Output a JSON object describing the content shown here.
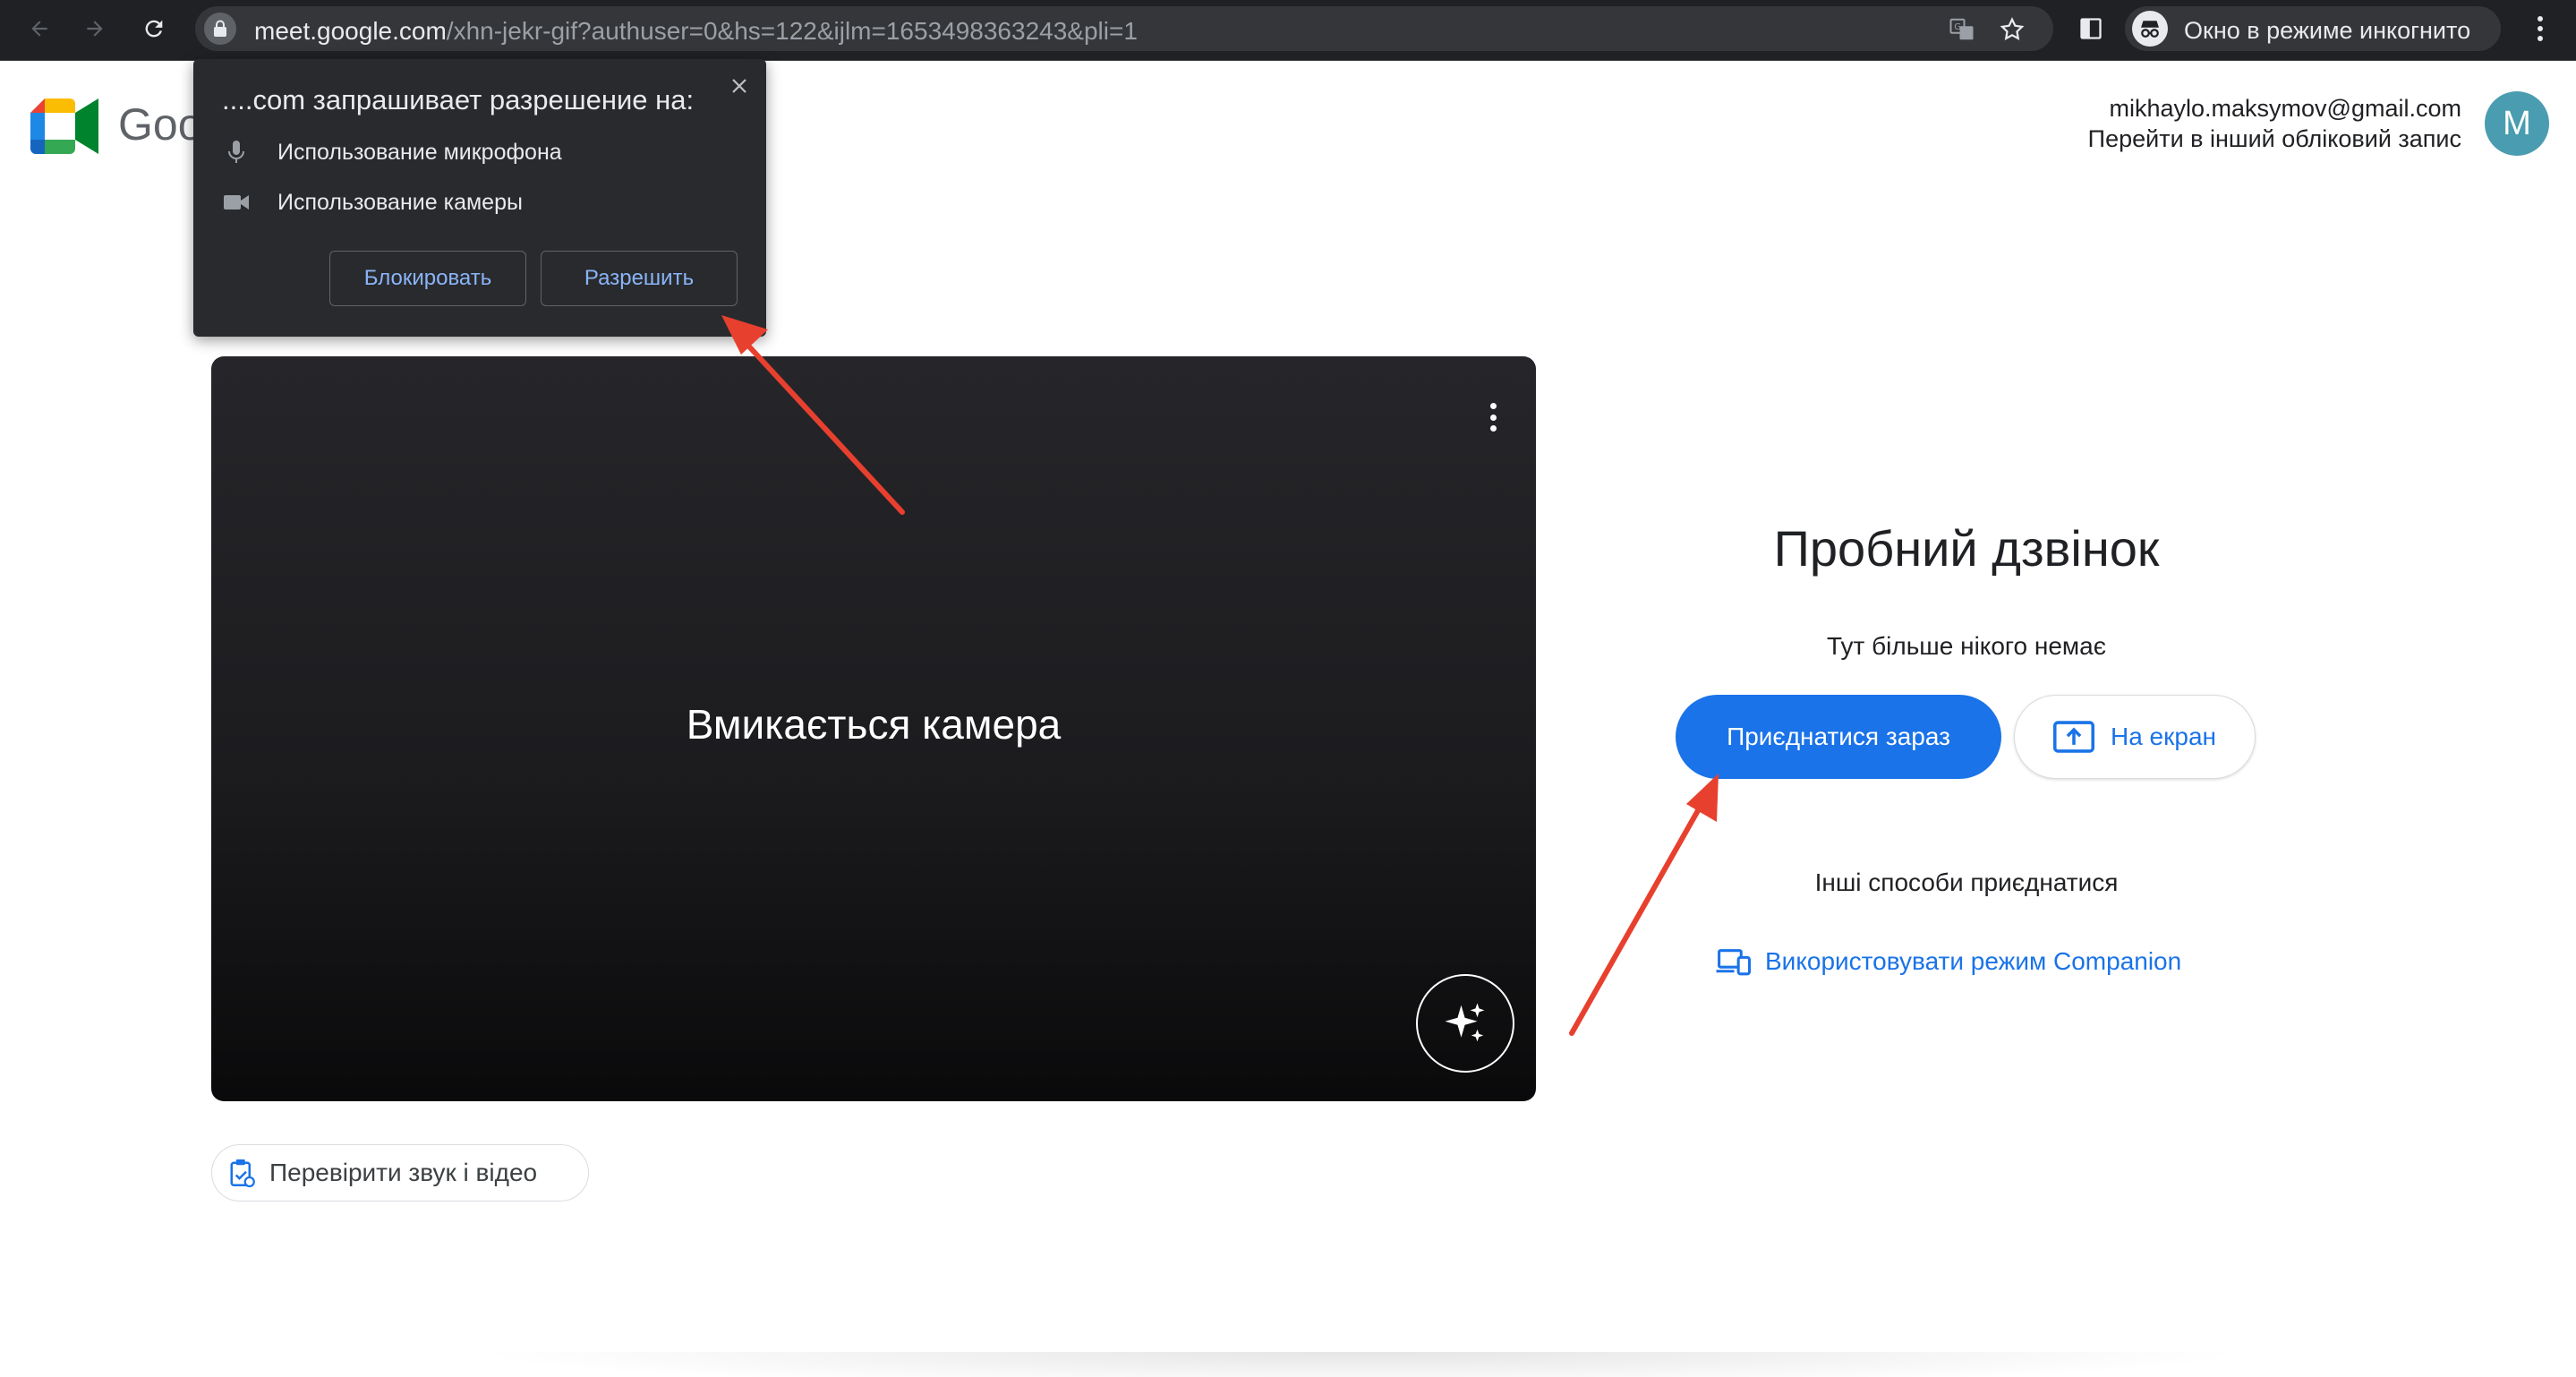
{
  "browser": {
    "url_host": "meet.google.com",
    "url_path": "/xhn-jekr-gif?authuser=0&hs=122&ijlm=1653498363243&pli=1",
    "incognito_label": "Окно в режиме инкогнито"
  },
  "header": {
    "brand": "Goo",
    "account_email": "mikhaylo.maksymov@gmail.com",
    "switch_account": "Перейти в інший обліковий запис",
    "avatar_letter": "M"
  },
  "permission_popup": {
    "title": "....com запрашивает разрешение на:",
    "items": [
      {
        "icon": "microphone-icon",
        "label": "Использование микрофона"
      },
      {
        "icon": "camera-icon",
        "label": "Использование камеры"
      }
    ],
    "block_label": "Блокировать",
    "allow_label": "Разрешить"
  },
  "preview": {
    "status_text": "Вмикається камера",
    "check_label": "Перевірити звук і відео"
  },
  "join_panel": {
    "title": "Пробний дзвінок",
    "subtitle": "Тут більше нікого немає",
    "join_label": "Приєднатися зараз",
    "present_label": "На екран",
    "other_ways": "Інші способи приєднатися",
    "companion_label": "Використовувати режим Companion"
  },
  "colors": {
    "accent": "#1a73e8",
    "annotation_arrow": "#e8402e"
  }
}
